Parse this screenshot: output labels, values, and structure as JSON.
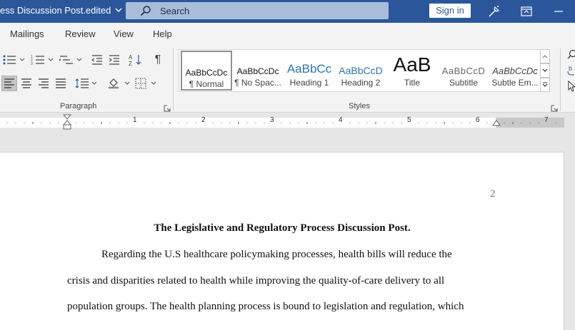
{
  "titlebar": {
    "doc_title": "ess Discussion Post.edited",
    "search_placeholder": "Search",
    "signin_label": "Sign in"
  },
  "tabs": [
    {
      "label": "Mailings"
    },
    {
      "label": "Review"
    },
    {
      "label": "View"
    },
    {
      "label": "Help"
    }
  ],
  "ribbon": {
    "paragraph_label": "Paragraph",
    "styles_label": "Styles",
    "styles": [
      {
        "sample": "AaBbCcDc",
        "name": "¶ Normal"
      },
      {
        "sample": "AaBbCcDc",
        "name": "¶ No Spac..."
      },
      {
        "sample": "AaBbCc",
        "name": "Heading 1"
      },
      {
        "sample": "AaBbCcD",
        "name": "Heading 2"
      },
      {
        "sample": "AaB",
        "name": "Title"
      },
      {
        "sample": "AaBbCcD",
        "name": "Subtitle"
      },
      {
        "sample": "AaBbCcDc",
        "name": "Subtle Em..."
      }
    ]
  },
  "ruler": {
    "numbers": [
      "1",
      "2",
      "3",
      "4",
      "5",
      "6",
      "7"
    ]
  },
  "document": {
    "page_number": "2",
    "heading": "The Legislative and Regulatory Process Discussion Post.",
    "lines": [
      "Regarding the U.S healthcare policymaking processes, health bills will reduce the",
      "crisis and disparities related to health while improving the quality-of-care delivery to all",
      "population groups. The health planning process is bound to legislation and regulation, which"
    ]
  },
  "colors": {
    "accent": "#2b579a",
    "ribbon_bg": "#f3f3f3",
    "heading_blue": "#2e74b5"
  }
}
